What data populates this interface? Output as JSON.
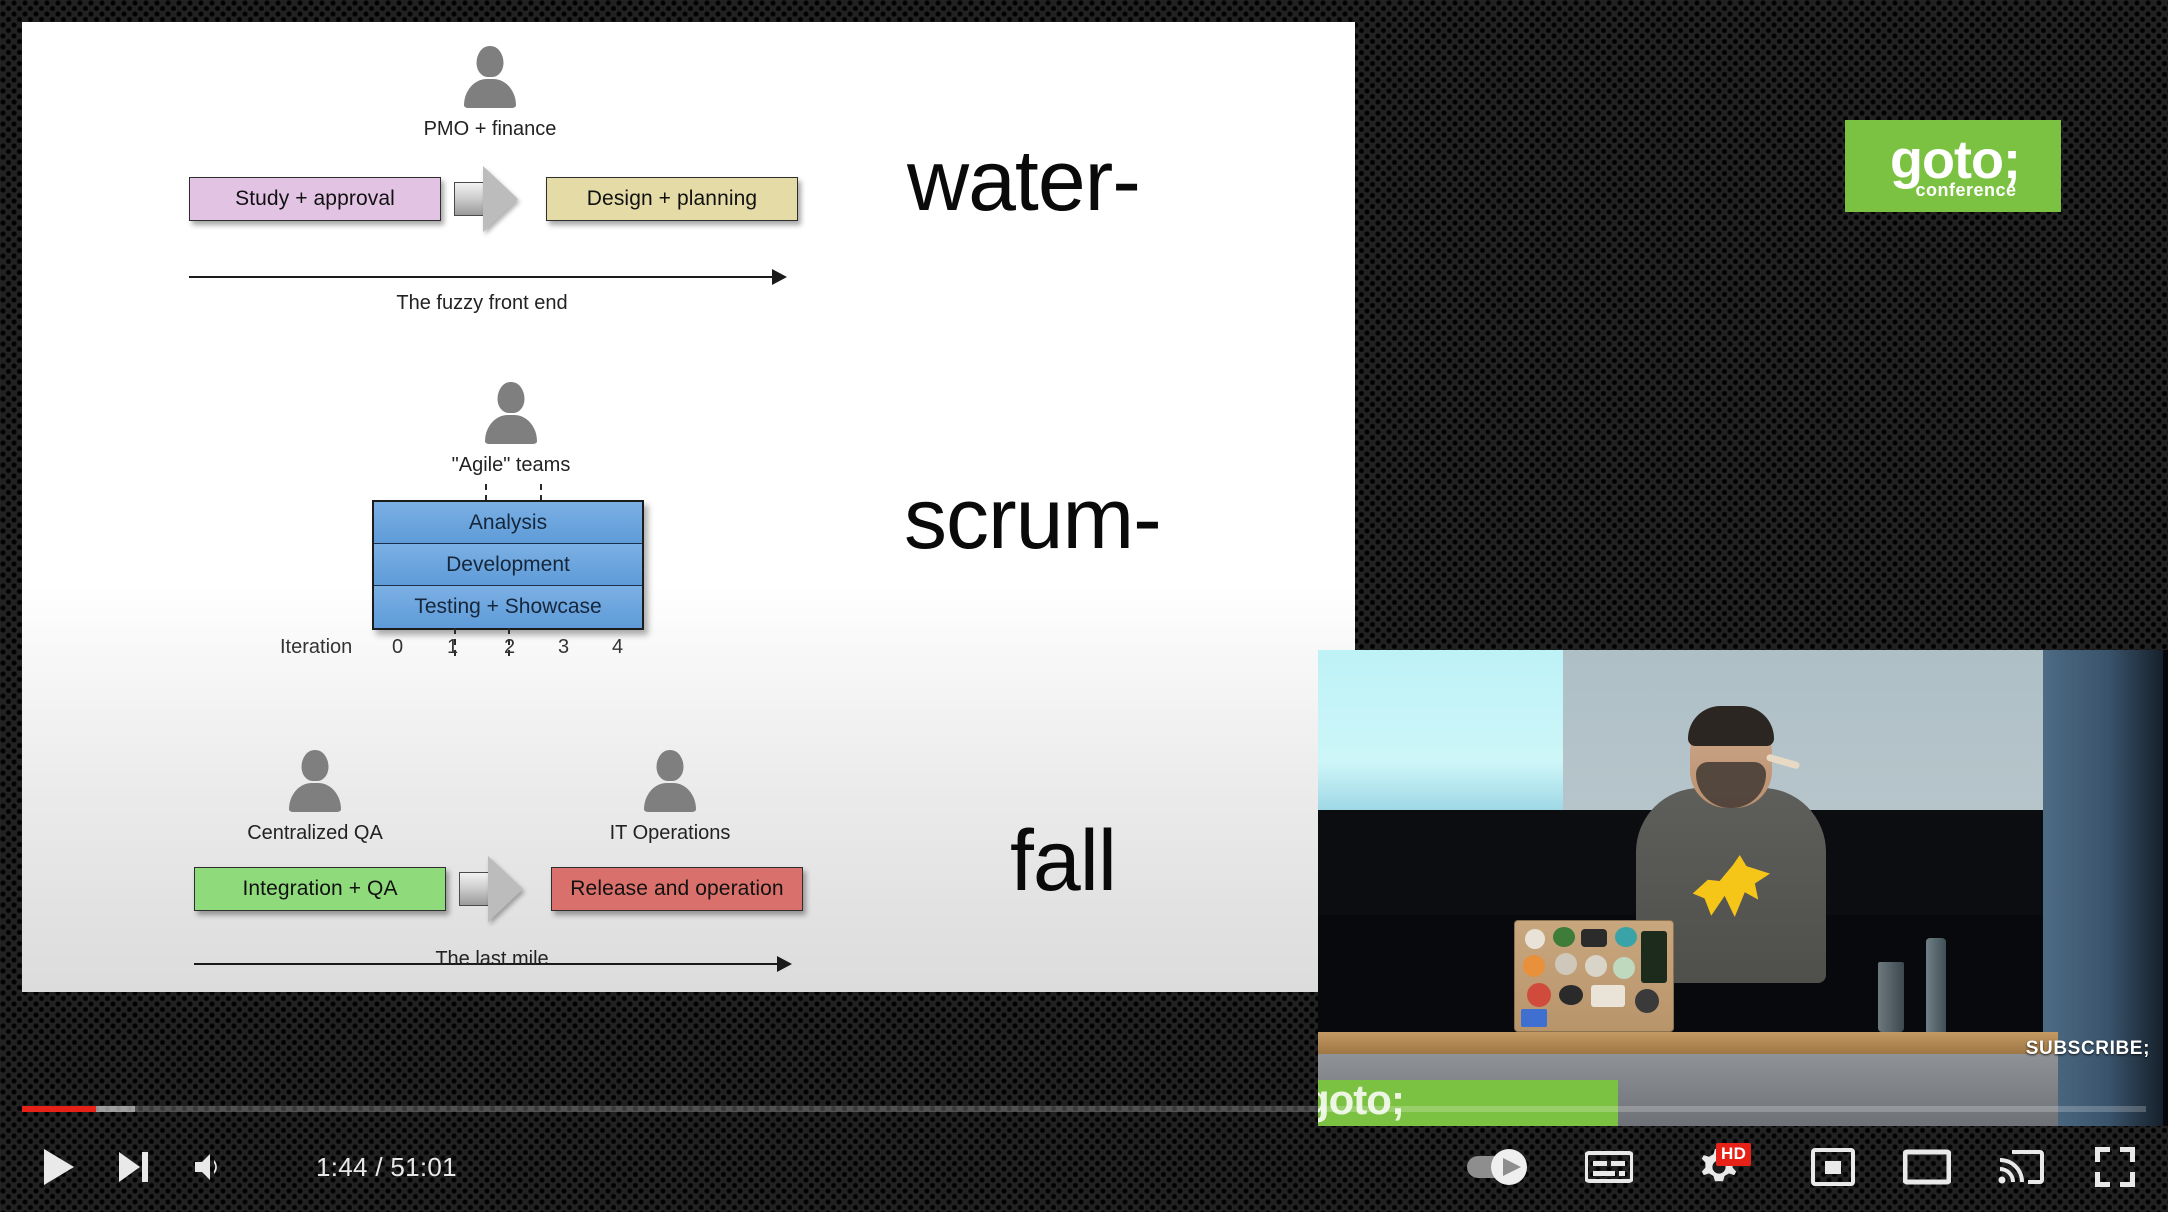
{
  "player": {
    "progress": {
      "played_pct": 3.5,
      "loaded_pct": 5.3,
      "accent_color": "#e62117"
    },
    "time_display": "1:44 / 51:01",
    "current_time": "1:44",
    "duration": "51:01",
    "controls": {
      "play": "Play",
      "next": "Next",
      "volume": "Mute",
      "autoplay": "Autoplay",
      "subtitles": "Subtitles/closed captions",
      "settings": "Settings",
      "quality_badge": "HD",
      "miniplayer": "Miniplayer",
      "theater": "Theater mode",
      "cast": "Play on TV",
      "fullscreen": "Full screen"
    }
  },
  "watermark": {
    "brand": "goto;",
    "sub": "conference",
    "brand_color": "#7cc242"
  },
  "video": {
    "overlay_text": "SUBSCRIBE;",
    "podium_brand": "goto;"
  },
  "slide": {
    "headline_parts": [
      "water-",
      "scrum-",
      "fall"
    ],
    "rows": [
      {
        "id": "front-end",
        "actor": "PMO + finance",
        "boxes": [
          {
            "label": "Study + approval",
            "color": "#e2c3e4"
          },
          {
            "label": "Design + planning",
            "color": "#e4dba6"
          }
        ],
        "axis_label": "The fuzzy front end",
        "headline": "water-"
      },
      {
        "id": "iterations",
        "actor": "\"Agile\" teams",
        "stack": [
          {
            "label": "Analysis",
            "color": "#6aa5de"
          },
          {
            "label": "Development",
            "color": "#6aa5de"
          },
          {
            "label": "Testing + Showcase",
            "color": "#6aa5de"
          }
        ],
        "axis_title": "Iteration",
        "axis_ticks": [
          "0",
          "1",
          "2",
          "3",
          "4"
        ],
        "headline": "scrum-"
      },
      {
        "id": "last-mile",
        "actors": [
          "Centralized QA",
          "IT Operations"
        ],
        "boxes": [
          {
            "label": "Integration + QA",
            "color": "#8fdb7c"
          },
          {
            "label": "Release and operation",
            "color": "#d9706b"
          }
        ],
        "axis_label": "The last mile",
        "headline": "fall"
      }
    ]
  }
}
